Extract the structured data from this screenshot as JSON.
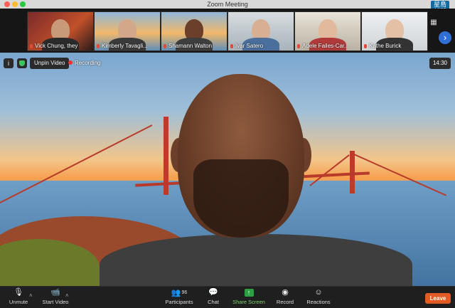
{
  "window": {
    "title": "Zoom Meeting"
  },
  "watermark": {
    "text": "星島\n新聞"
  },
  "participants_strip": [
    {
      "name": "Vick Chung, they"
    },
    {
      "name": "Kimberly Tavagli..."
    },
    {
      "name": "Shamann Walton"
    },
    {
      "name": "Ivar Satero"
    },
    {
      "name": "Adele Failes-Car..."
    },
    {
      "name": "Kathe Burick"
    }
  ],
  "overlay": {
    "unpin_label": "Unpin Video",
    "recording_label": "Recording",
    "timer": "14:30"
  },
  "toolbar": {
    "unmute": "Unmute",
    "start_video": "Start Video",
    "participants": "Participants",
    "participants_count": "96",
    "chat": "Chat",
    "share_screen": "Share Screen",
    "record": "Record",
    "reactions": "Reactions",
    "leave": "Leave"
  },
  "colors": {
    "leave": "#e45a24",
    "share_green": "#2ea043",
    "accent_blue": "#2f6fd6",
    "recording_red": "#e33333"
  }
}
